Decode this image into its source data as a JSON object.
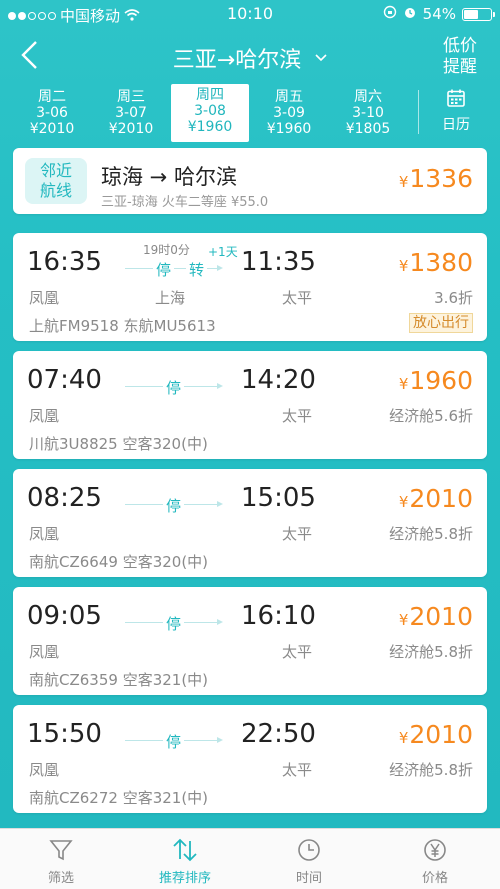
{
  "status_bar": {
    "carrier": "中国移动",
    "time": "10:10",
    "battery": "54%",
    "battery_level": 0.54
  },
  "nav": {
    "title": "三亚→哈尔滨",
    "right_line1": "低价",
    "right_line2": "提醒"
  },
  "dates": [
    {
      "weekday": "周二",
      "date": "3-06",
      "price": "¥2010",
      "active": false
    },
    {
      "weekday": "周三",
      "date": "3-07",
      "price": "¥2010",
      "active": false
    },
    {
      "weekday": "周四",
      "date": "3-08",
      "price": "¥1960",
      "active": true
    },
    {
      "weekday": "周五",
      "date": "3-09",
      "price": "¥1960",
      "active": false
    },
    {
      "weekday": "周六",
      "date": "3-10",
      "price": "¥1805",
      "active": false
    }
  ],
  "calendar_label": "日历",
  "nearby": {
    "badge_line1": "邻近",
    "badge_line2": "航线",
    "route": "琼海 → 哈尔滨",
    "sub": "三亚-琼海 火车二等座 ¥55.0",
    "price": "1336"
  },
  "flights": [
    {
      "dep_time": "16:35",
      "arr_time": "11:35",
      "dep_airport": "凤凰",
      "arr_airport": "太平",
      "stop": "停",
      "transfer": "转",
      "duration": "19时0分",
      "plus_day": "+1天",
      "transfer_city": "上海",
      "info": "上航FM9518  东航MU5613",
      "price": "1380",
      "discount": "3.6折",
      "tag": "放心出行"
    },
    {
      "dep_time": "07:40",
      "arr_time": "14:20",
      "dep_airport": "凤凰",
      "arr_airport": "太平",
      "stop": "停",
      "info": "川航3U8825  空客320(中)",
      "price": "1960",
      "discount": "经济舱5.6折"
    },
    {
      "dep_time": "08:25",
      "arr_time": "15:05",
      "dep_airport": "凤凰",
      "arr_airport": "太平",
      "stop": "停",
      "info": "南航CZ6649  空客320(中)",
      "price": "2010",
      "discount": "经济舱5.8折"
    },
    {
      "dep_time": "09:05",
      "arr_time": "16:10",
      "dep_airport": "凤凰",
      "arr_airport": "太平",
      "stop": "停",
      "info": "南航CZ6359  空客321(中)",
      "price": "2010",
      "discount": "经济舱5.8折"
    },
    {
      "dep_time": "15:50",
      "arr_time": "22:50",
      "dep_airport": "凤凰",
      "arr_airport": "太平",
      "stop": "停",
      "info": "南航CZ6272  空客321(中)",
      "price": "2010",
      "discount": "经济舱5.8折"
    }
  ],
  "tabs": [
    {
      "label": "筛选",
      "icon": "filter-icon",
      "active": false
    },
    {
      "label": "推荐排序",
      "icon": "sort-icon",
      "active": true
    },
    {
      "label": "时间",
      "icon": "clock-icon",
      "active": false
    },
    {
      "label": "价格",
      "icon": "yen-icon",
      "active": false
    }
  ],
  "colors": {
    "accent": "#22b8bf",
    "price": "#f6891f"
  }
}
